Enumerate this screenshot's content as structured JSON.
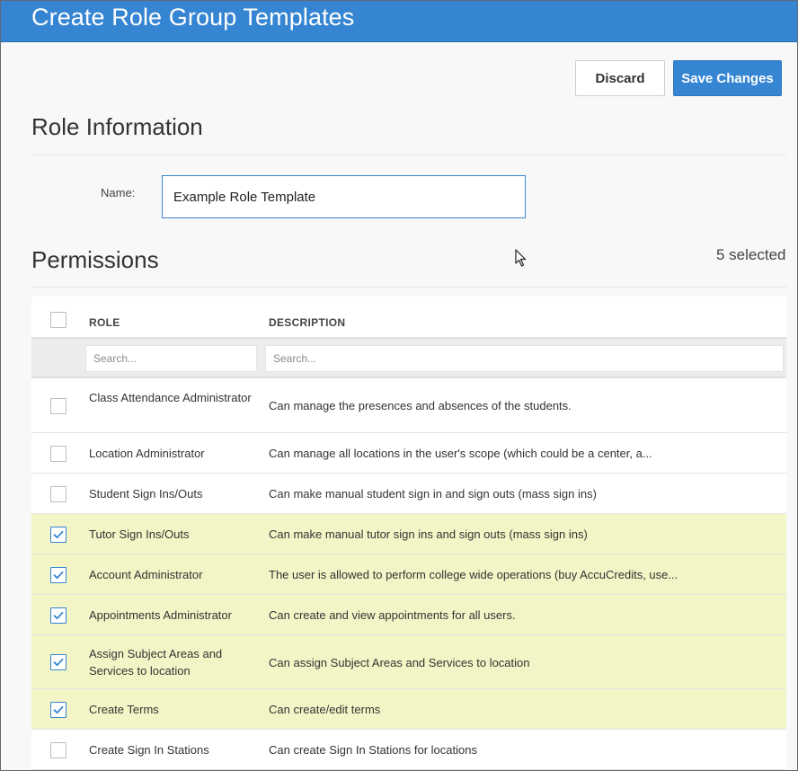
{
  "window": {
    "title": "Create Role Group Templates"
  },
  "toolbar": {
    "discard_label": "Discard",
    "save_label": "Save Changes"
  },
  "role_info": {
    "heading": "Role Information",
    "name_label": "Name:",
    "name_value": "Example Role Template"
  },
  "permissions": {
    "heading": "Permissions",
    "selected_count": "5 selected",
    "columns": {
      "role": "ROLE",
      "description": "DESCRIPTION"
    },
    "filters": {
      "role_placeholder": "Search...",
      "description_placeholder": "Search..."
    },
    "rows": [
      {
        "role": "Class Attendance Administrator",
        "description": "Can manage the presences and absences of the students.",
        "checked": false
      },
      {
        "role": "Location Administrator",
        "description": "Can manage all locations in the user's scope (which could be a center, a...",
        "checked": false
      },
      {
        "role": "Student Sign Ins/Outs",
        "description": "Can make manual student sign in and sign outs (mass sign ins)",
        "checked": false
      },
      {
        "role": "Tutor Sign Ins/Outs",
        "description": "Can make manual tutor sign ins and sign outs (mass sign ins)",
        "checked": true
      },
      {
        "role": "Account Administrator",
        "description": "The user is allowed to perform college wide operations (buy AccuCredits, use...",
        "checked": true
      },
      {
        "role": "Appointments Administrator",
        "description": "Can create and view appointments for all users.",
        "checked": true
      },
      {
        "role": "Assign Subject Areas and Services to location",
        "description": "Can assign Subject Areas and Services to location",
        "checked": true
      },
      {
        "role": "Create Terms",
        "description": "Can create/edit terms",
        "checked": true
      },
      {
        "role": "Create Sign In Stations",
        "description": "Can create Sign In Stations for locations",
        "checked": false
      }
    ]
  },
  "colors": {
    "accent": "#3585d2",
    "selected_row": "#f3f5c6"
  }
}
